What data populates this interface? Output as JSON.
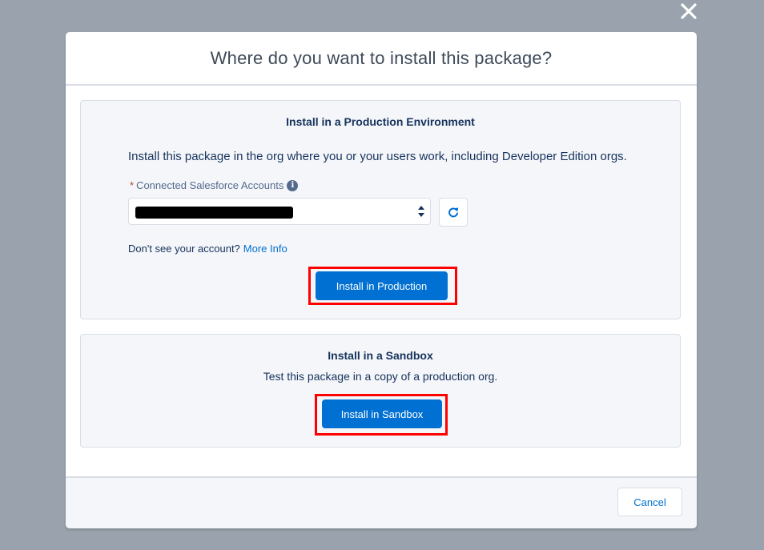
{
  "modal": {
    "title": "Where do you want to install this package?",
    "close_icon": "close-icon"
  },
  "production": {
    "title": "Install in a Production Environment",
    "description": "Install this package in the org where you or your users work, including Developer Edition orgs.",
    "field": {
      "required_marker": "*",
      "label": "Connected Salesforce Accounts",
      "info_glyph": "i",
      "selected_value": "",
      "value_redacted": true
    },
    "help_text": "Don't see your account?",
    "help_link": "More Info",
    "install_button": "Install in Production"
  },
  "sandbox": {
    "title": "Install in a Sandbox",
    "description": "Test this package in a copy of a production org.",
    "install_button": "Install in Sandbox"
  },
  "footer": {
    "cancel_button": "Cancel"
  },
  "colors": {
    "backdrop": "#9aa3ad",
    "brand": "#0070d2",
    "highlight": "#ff0000",
    "card_bg": "#f4f6f9",
    "text": "#16325c"
  },
  "icons": {
    "close": "close-icon",
    "info": "info-icon",
    "select_arrows": "select-arrows-icon",
    "refresh": "refresh-icon"
  }
}
